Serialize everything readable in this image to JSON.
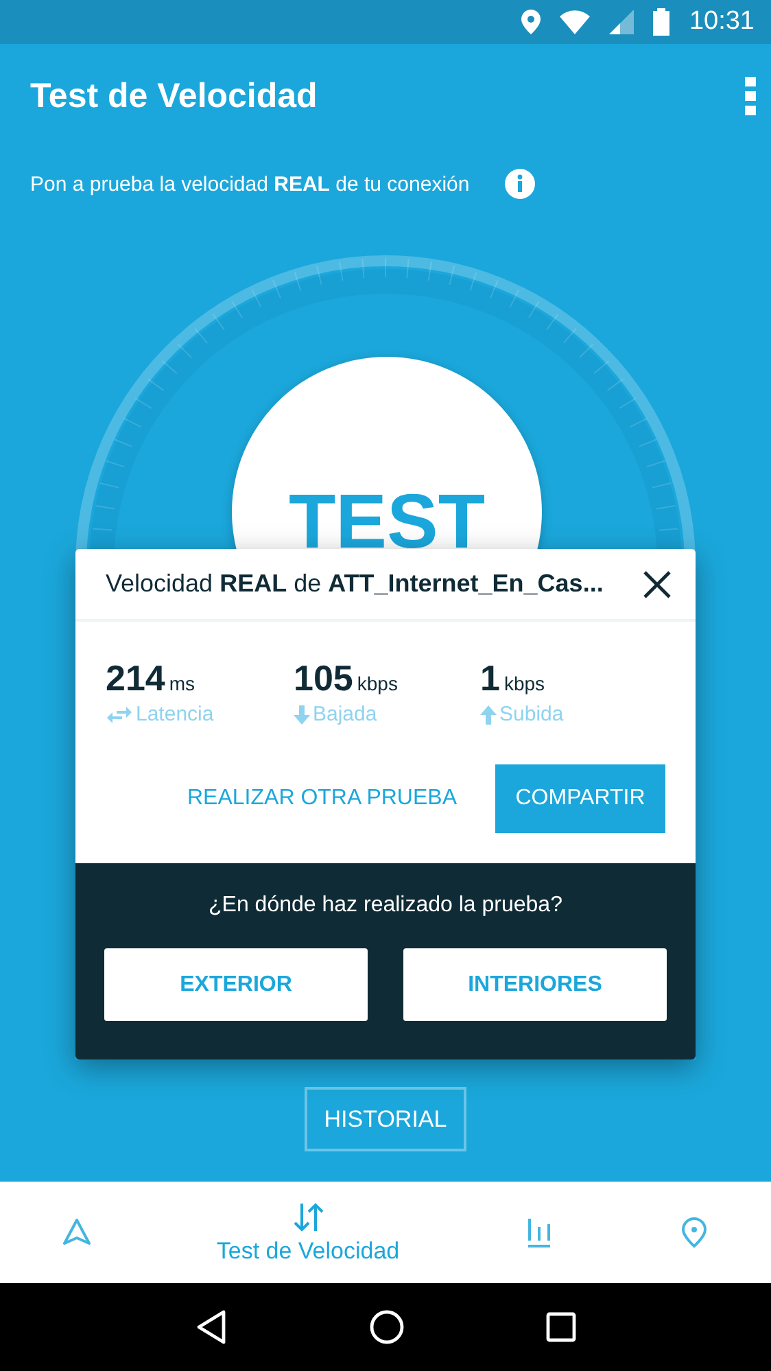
{
  "status_bar": {
    "time": "10:31"
  },
  "app_bar": {
    "title": "Test de Velocidad"
  },
  "subtitle": "Pon a prueba la velocidad **REAL** de tu conexión",
  "gauge": {
    "button_label": "TEST"
  },
  "result_dialog": {
    "title": "Velocidad **REAL** de **ATT_Internet_En_Cas...**",
    "metrics": [
      {
        "value": "214",
        "unit": "ms",
        "label": "Latencia"
      },
      {
        "value": "105",
        "unit": "kbps",
        "label": "Bajada"
      },
      {
        "value": "1",
        "unit": "kbps",
        "label": "Subida"
      }
    ],
    "secondary_action": "REALIZAR OTRA PRUEBA",
    "primary_action": "COMPARTIR",
    "question": "¿En dónde haz realizado la prueba?",
    "choices": [
      "EXTERIOR",
      "INTERIORES"
    ]
  },
  "history_button": "HISTORIAL",
  "bottom_nav": [
    {
      "selected": false
    },
    {
      "selected": true,
      "label": "Test de Velocidad"
    },
    {
      "selected": false
    },
    {
      "selected": false
    }
  ]
}
